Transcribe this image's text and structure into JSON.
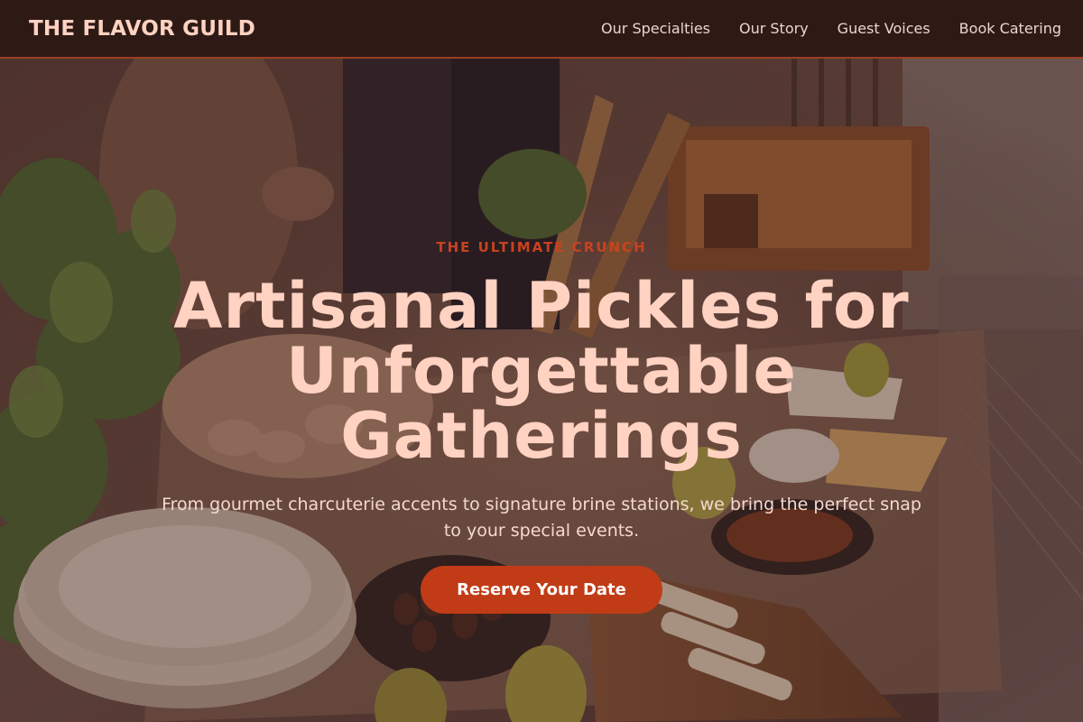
{
  "header": {
    "brand": "THE FLAVOR GUILD",
    "nav": [
      {
        "label": "Our Specialties"
      },
      {
        "label": "Our Story"
      },
      {
        "label": "Guest Voices"
      },
      {
        "label": "Book Catering"
      }
    ]
  },
  "hero": {
    "eyebrow": "THE ULTIMATE CRUNCH",
    "headline": "Artisanal Pickles for Unforgettable Gatherings",
    "subhead": "From gourmet charcuterie accents to signature brine stations, we bring the perfect snap to your special events.",
    "cta_label": "Reserve Your Date",
    "background_image": "catering-spread-photo"
  },
  "colors": {
    "header_bg": "#2e1a15",
    "accent": "#c13c16",
    "headline": "#ffd2c2",
    "eyebrow": "#c8431e"
  }
}
